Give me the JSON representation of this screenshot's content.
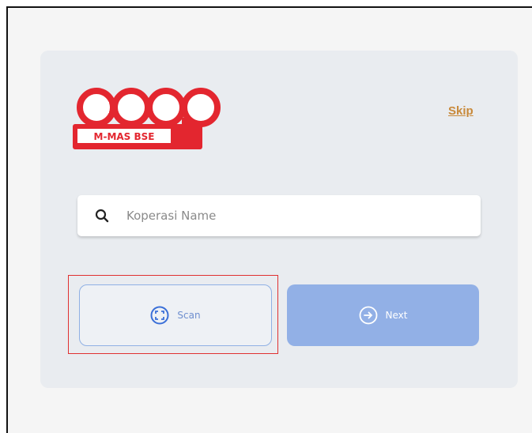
{
  "brand": {
    "logo_word": "COOP",
    "logo_sub": "M-MAS BSE",
    "logo_color": "#e3262f"
  },
  "header": {
    "skip_label": "Skip"
  },
  "search": {
    "placeholder": "Koperasi Name",
    "value": "",
    "icon": "search-icon"
  },
  "actions": {
    "scan_label": "Scan",
    "scan_icon": "scan-icon",
    "next_label": "Next",
    "next_icon": "arrow-right-circle-icon"
  },
  "colors": {
    "accent": "#8fb0e4",
    "next_bg": "#92b0e6",
    "skip": "#c8893a",
    "highlight": "#e03131",
    "card": "#e9ecf0"
  }
}
